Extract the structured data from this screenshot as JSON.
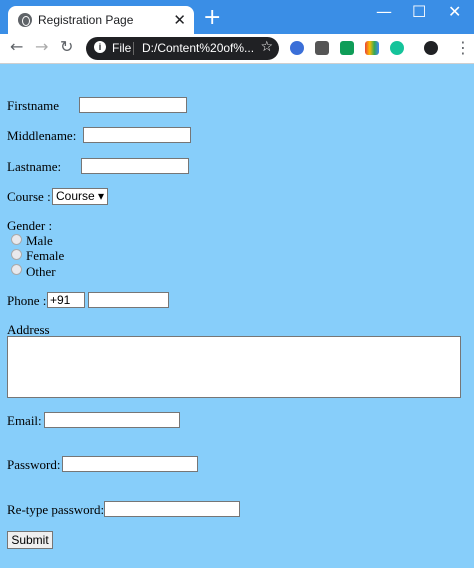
{
  "browser": {
    "tab_title": "Registration Page",
    "tab_close": "✕",
    "new_tab": "+",
    "window": {
      "minimize": "—",
      "maximize": "☐",
      "close": "✕"
    },
    "nav": {
      "back": "←",
      "forward": "→",
      "reload": "↻"
    },
    "omnibox": {
      "info": "i",
      "scheme_label": "File",
      "url": "D:/Content%20of%...",
      "star": "☆"
    },
    "extensions": [
      {
        "icon": "extension-blue-icon",
        "color": "#3b6fd8"
      },
      {
        "icon": "extension-m-icon",
        "color": "#555555"
      },
      {
        "icon": "extension-green-icon",
        "color": "#0f9d58"
      },
      {
        "icon": "extension-colorful-icon",
        "color": "#fbbc05"
      },
      {
        "icon": "grammarly-icon",
        "color": "#15c39a"
      }
    ],
    "menu": "⋮",
    "profile_icon": "profile-icon"
  },
  "form": {
    "firstname_label": "Firstname",
    "middlename_label": "Middlename:",
    "lastname_label": "Lastname:",
    "course_label": "Course :",
    "course_selected": "Course ▾",
    "gender_label": "Gender :",
    "gender_options": [
      "Male",
      "Female",
      "Other"
    ],
    "phone_label": "Phone :",
    "phone_code": "+91",
    "address_label": "Address",
    "email_label": "Email:",
    "password_label": "Password:",
    "retype_label": "Re-type password:",
    "submit_label": "Submit"
  },
  "colors": {
    "page_background": "#87cefa",
    "tabstrip": "#3a8ee6"
  }
}
